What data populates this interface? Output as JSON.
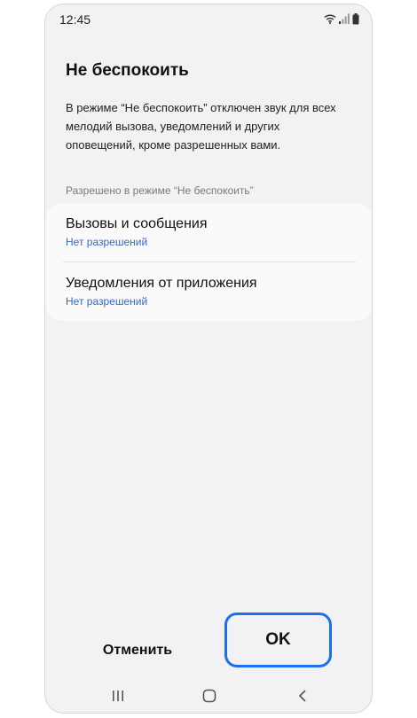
{
  "status_bar": {
    "time": "12:45",
    "icons": [
      "wifi-icon",
      "signal-icon",
      "battery-icon"
    ]
  },
  "dialog": {
    "title": "Не беспокоить",
    "description": "В режиме “Не беспокоить” отключен звук для всех мелодий вызова, уведомлений и других оповещений, кроме разрешенных вами.",
    "section_label": "Разрешено в режиме “Не беспокоить”",
    "items": [
      {
        "title": "Вызовы и сообщения",
        "subtitle": "Нет разрешений"
      },
      {
        "title": "Уведомления от приложения",
        "subtitle": "Нет разрешений"
      }
    ],
    "cancel_label": "Отменить",
    "ok_label": "OK"
  },
  "nav_bar": {
    "buttons": [
      "recent-apps-icon",
      "home-icon",
      "back-icon"
    ]
  },
  "colors": {
    "background": "#f2f2f4",
    "card": "#fafafb",
    "link": "#3569c9",
    "highlight": "#1d6ff0"
  }
}
